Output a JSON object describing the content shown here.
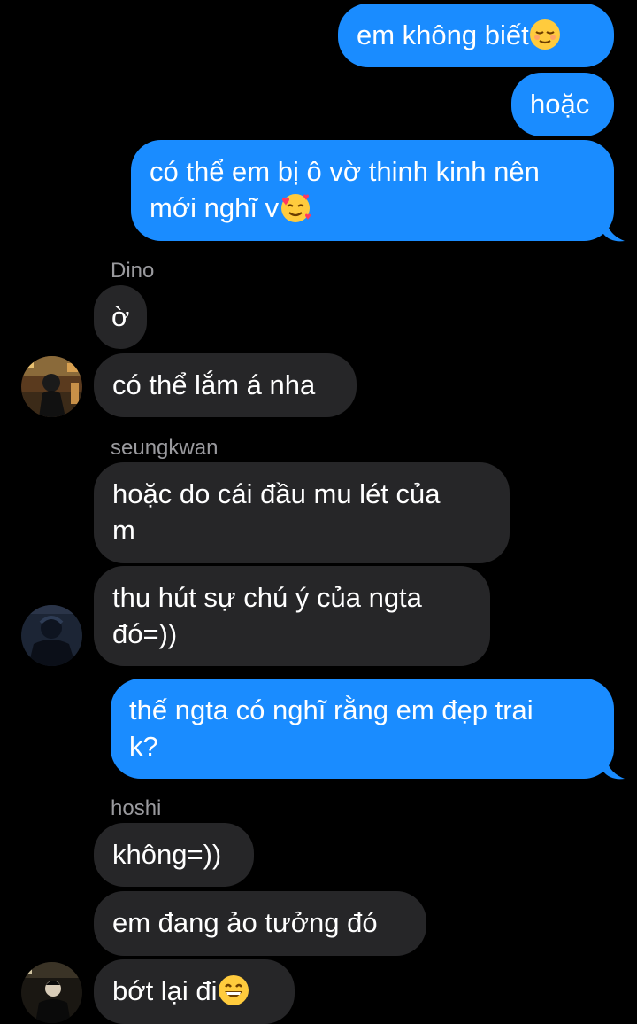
{
  "colors": {
    "background": "#000000",
    "outgoing_bubble": "#1a8cff",
    "incoming_bubble": "#262628",
    "sender_name": "#9a9a9e"
  },
  "messages": {
    "m1": {
      "text": "em không biết",
      "emoji": "relieved-face-emoji"
    },
    "m2": {
      "text": "hoặc"
    },
    "m3": {
      "line1": "có thể em bị ô vờ thinh kinh nên",
      "line2": "mới nghĩ v",
      "emoji": "smiling-face-with-hearts-emoji"
    },
    "dino": {
      "name": "Dino",
      "avatar": "dino-avatar-photo",
      "m1": {
        "text": "ờ"
      },
      "m2": {
        "text": "có thể lắm á nha"
      }
    },
    "seungkwan": {
      "name": "seungkwan",
      "avatar": "seungkwan-avatar-photo",
      "m1": {
        "line1": "hoặc do cái đầu mu lét của",
        "line2": "m"
      },
      "m2": {
        "line1": "thu hút sự chú ý của ngta",
        "line2": "đó=))"
      }
    },
    "m4": {
      "line1": "thế ngta có nghĩ rằng em đẹp trai",
      "line2": "k?"
    },
    "hoshi": {
      "name": "hoshi",
      "avatar": "hoshi-avatar-photo",
      "m1": {
        "text": "không=))"
      },
      "m2": {
        "text": "em đang ảo tưởng đó"
      },
      "m3": {
        "text": "bớt lại đi",
        "emoji": "grinning-face-emoji"
      }
    }
  }
}
